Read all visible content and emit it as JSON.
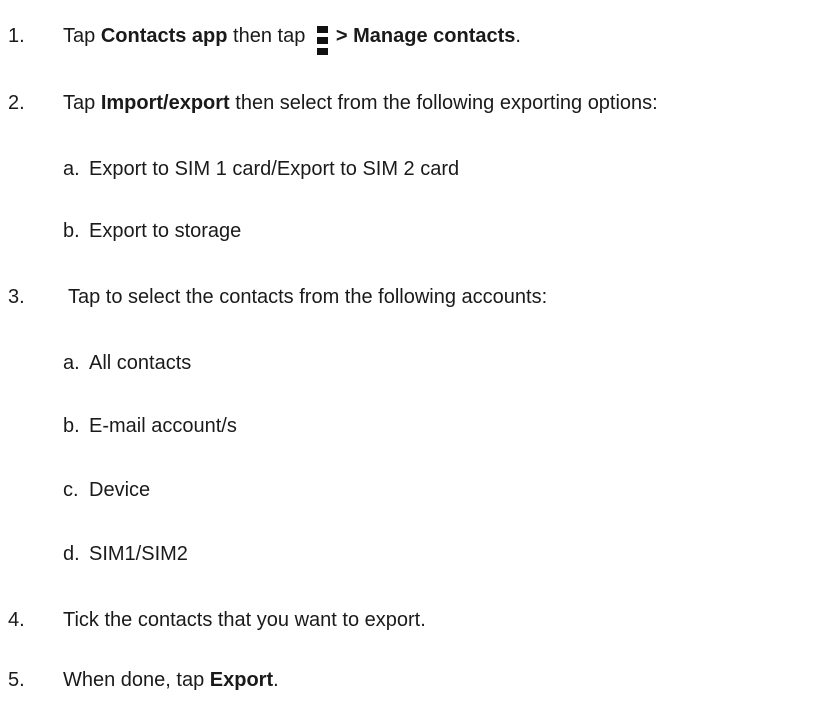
{
  "steps": [
    {
      "number": "1.",
      "prefix": "Tap ",
      "bold1": "Contacts app",
      "middle": " then tap ",
      "bold2": "> Manage contacts",
      "suffix": "."
    },
    {
      "number": "2.",
      "prefix": "Tap ",
      "bold1": "Import/export",
      "suffix": " then select from the following exporting options:",
      "options": [
        {
          "letter": "a.",
          "text": "Export to SIM 1 card/Export to SIM 2 card"
        },
        {
          "letter": "b.",
          "text": "Export to storage"
        }
      ]
    },
    {
      "number": "3.",
      "text": "Tap to select the contacts from the following accounts:",
      "options": [
        {
          "letter": "a.",
          "text": "All contacts"
        },
        {
          "letter": "b.",
          "text": "E-mail account/s"
        },
        {
          "letter": "c.",
          "text": "Device"
        },
        {
          "letter": "d.",
          "text": "SIM1/SIM2"
        }
      ]
    },
    {
      "number": "4.",
      "text": "Tick the contacts that you want to export."
    },
    {
      "number": "5.",
      "prefix": "When done, tap ",
      "bold1": "Export",
      "suffix": "."
    }
  ],
  "icons": {
    "overflow_menu": "more-vertical-icon"
  }
}
